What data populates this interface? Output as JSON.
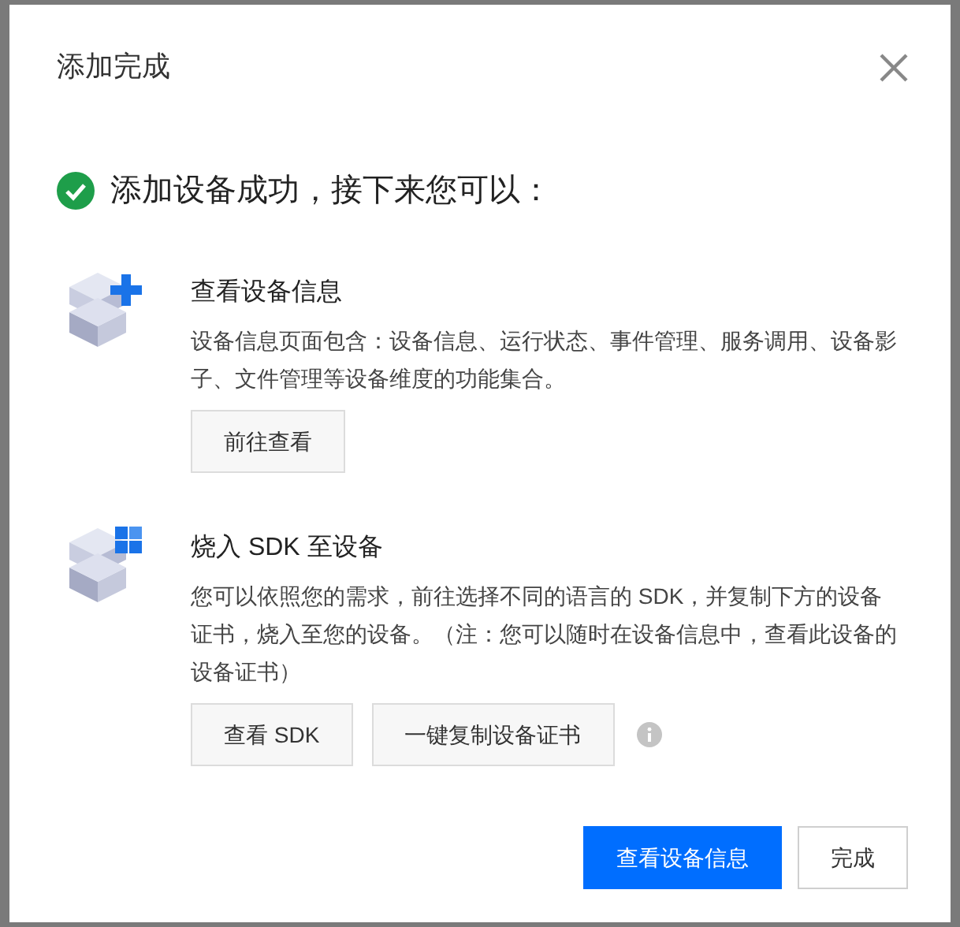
{
  "dialog": {
    "title": "添加完成",
    "headline": "添加设备成功，接下来您可以：",
    "sections": [
      {
        "kind": "info",
        "title": "查看设备信息",
        "description": "设备信息页面包含：设备信息、运行状态、事件管理、服务调用、设备影子、文件管理等设备维度的功能集合。",
        "buttons": [
          "前往查看"
        ],
        "info_icon": false
      },
      {
        "kind": "sdk",
        "title": "烧入 SDK 至设备",
        "description": "您可以依照您的需求，前往选择不同的语言的 SDK，并复制下方的设备证书，烧入至您的设备。（注：您可以随时在设备信息中，查看此设备的设备证书）",
        "buttons": [
          "查看 SDK",
          "一键复制设备证书"
        ],
        "info_icon": true
      }
    ],
    "footer_buttons": [
      {
        "label": "查看设备信息",
        "kind": "primary"
      },
      {
        "label": "完成",
        "kind": "default"
      }
    ]
  }
}
